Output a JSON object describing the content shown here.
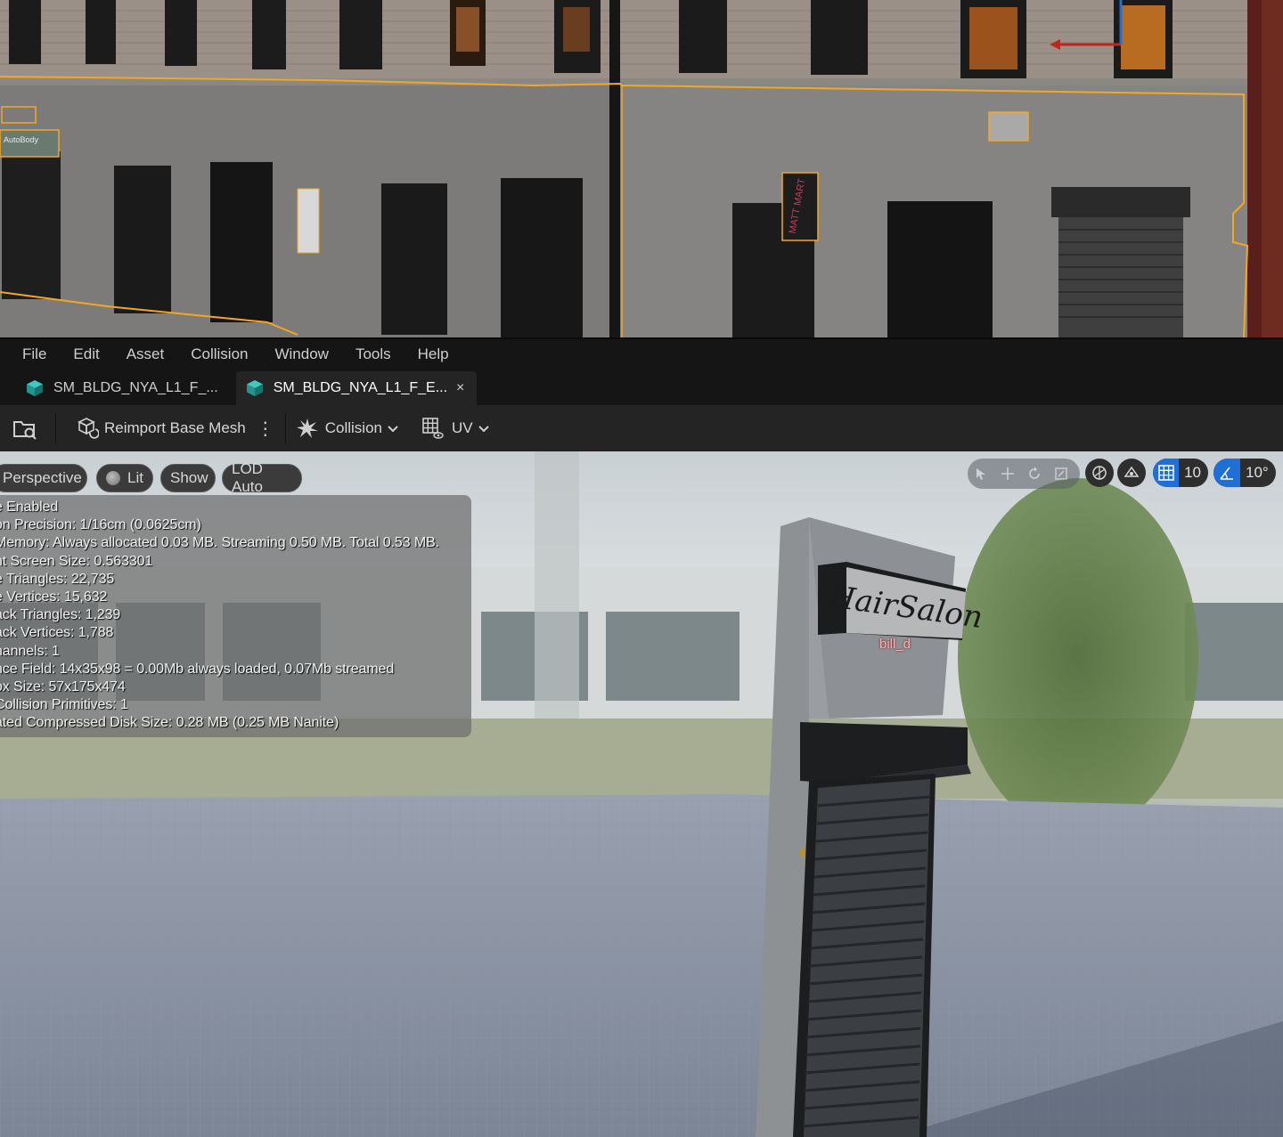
{
  "menu": {
    "items": [
      "File",
      "Edit",
      "Asset",
      "Collision",
      "Window",
      "Tools",
      "Help"
    ]
  },
  "tabs": [
    {
      "label": "SM_BLDG_NYA_L1_F_...",
      "active": false
    },
    {
      "label": "SM_BLDG_NYA_L1_F_E...",
      "active": true,
      "close": "×"
    }
  ],
  "toolbar": {
    "reimport_label": "Reimport Base Mesh",
    "more_label": "⋮",
    "collision_label": "Collision",
    "uv_label": "UV"
  },
  "viewport": {
    "perspective_label": "Perspective",
    "lit_label": "Lit",
    "show_label": "Show",
    "lod_label": "LOD Auto",
    "grid_snap_value": "10",
    "rotation_snap_value": "10°",
    "socket_label": "bill_d",
    "sign_text": "HairSalon",
    "accent_color": "#1f6fd6",
    "selection_outline_color": "#f5a623"
  },
  "stats": {
    "lines": [
      "e Enabled",
      "on Precision: 1/16cm (0.0625cm)",
      "Memory: Always allocated 0.03 MB. Streaming 0.50 MB. Total 0.53 MB.",
      "nt Screen Size:  0.563301",
      "e Triangles:  22,735",
      "e Vertices:  15,632",
      "ack Triangles:  1,239",
      "ack Vertices:  1,788",
      "hannels:  1",
      "nce Field:  14x35x98 = 0.00Mb always loaded, 0.07Mb streamed",
      "ox Size: 57x175x474",
      "Collision Primitives:  1",
      "ated Compressed Disk Size: 0.28 MB (0.25 MB Nanite)"
    ]
  },
  "level": {
    "sign_matt_mart": "MATT MART",
    "sign_autobody": "AutoBody"
  }
}
